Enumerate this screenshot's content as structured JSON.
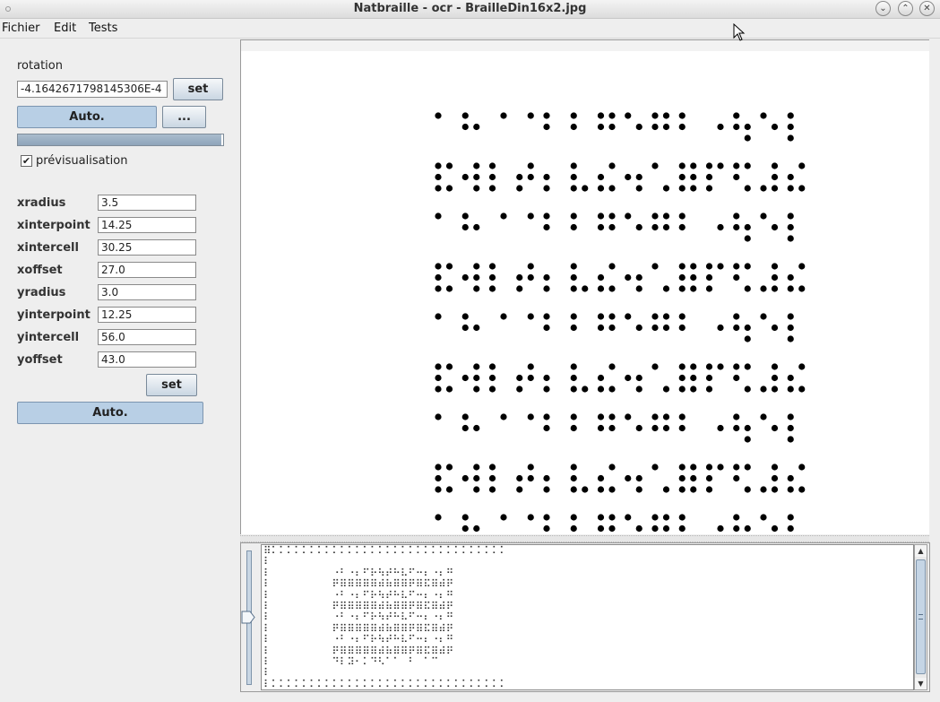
{
  "window": {
    "title": "Natbraille - ocr - BrailleDin16x2.jpg"
  },
  "menu": {
    "items": [
      "Fichier",
      "Edit",
      "Tests"
    ]
  },
  "rotation": {
    "label": "rotation",
    "value": "-4.1642671798145306E-4",
    "set_label": "set",
    "auto_label": "Auto.",
    "more_label": "...",
    "progress": 0.99
  },
  "preview": {
    "label": "prévisualisation",
    "checked": true,
    "mark": "✔"
  },
  "params": [
    {
      "label": "xradius",
      "value": "3.5"
    },
    {
      "label": "xinterpoint",
      "value": "14.25"
    },
    {
      "label": "xintercell",
      "value": "30.25"
    },
    {
      "label": "xoffset",
      "value": "27.0"
    },
    {
      "label": "yradius",
      "value": "3.0"
    },
    {
      "label": "yinterpoint",
      "value": "12.25"
    },
    {
      "label": "yintercell",
      "value": "56.0"
    },
    {
      "label": "yoffset",
      "value": "43.0"
    }
  ],
  "params_set_label": "set",
  "params_auto_label": "Auto.",
  "braille_lines": [
    "⠿⠅⠅⠅⠅⠅⠅⠅⠅⠅⠅⠅⠅⠅⠅⠅⠅⠅⠅⠅⠅⠅⠅⠅⠅⠅⠅⠅⠅⠅⠅⠅",
    "⠇⠀⠀⠀⠀⠀⠀⠀⠀⠀⠀⠀⠀⠀⠀⠀⠀⠀⠀⠀⠀⠀⠀⠀⠀⠀⠀⠀⠀⠀⠀⠀",
    "⠇⠀⠀⠀⠀⠀⠀⠀⠀⠐⠃⠐⠆⠋⠗⠳⠞⠓⠧⠋⠒⠆⠐⠆⠛⠀⠀⠀⠀⠀⠀⠀",
    "⠇⠀⠀⠀⠀⠀⠀⠀⠀⠟⠿⠿⠿⠿⠿⠾⠷⠿⠿⠟⠿⠯⠿⠾⠟⠀⠀⠀⠀⠀⠀⠀",
    "⠇⠀⠀⠀⠀⠀⠀⠀⠀⠐⠃⠐⠆⠋⠗⠳⠞⠓⠧⠋⠒⠆⠐⠆⠛⠀⠀⠀⠀⠀⠀⠀",
    "⠇⠀⠀⠀⠀⠀⠀⠀⠀⠟⠿⠿⠿⠿⠿⠾⠷⠿⠿⠟⠿⠯⠿⠾⠟⠀⠀⠀⠀⠀⠀⠀",
    "⠇⠀⠀⠀⠀⠀⠀⠀⠀⠐⠃⠐⠆⠋⠗⠳⠞⠓⠧⠋⠒⠆⠐⠆⠛⠀⠀⠀⠀⠀⠀⠀",
    "⠇⠀⠀⠀⠀⠀⠀⠀⠀⠟⠿⠿⠿⠿⠿⠾⠷⠿⠿⠟⠿⠯⠿⠾⠟⠀⠀⠀⠀⠀⠀⠀",
    "⠇⠀⠀⠀⠀⠀⠀⠀⠀⠐⠃⠐⠆⠋⠗⠳⠞⠓⠧⠋⠒⠆⠐⠆⠛⠀⠀⠀⠀⠀⠀⠀",
    "⠇⠀⠀⠀⠀⠀⠀⠀⠀⠟⠿⠿⠿⠿⠿⠾⠷⠿⠿⠟⠿⠯⠿⠾⠟⠀⠀⠀⠀⠀⠀⠀",
    "⠇⠀⠀⠀⠀⠀⠀⠀⠀⠙⠇⠽⠂⠅⠙⠣⠁⠁⠀⠃⠀⠁⠉⠀⠀⠀⠀⠀⠀⠀⠀⠀",
    "⠇⠀⠀⠀⠀⠀⠀⠀⠀⠀⠀⠀⠀⠀⠀⠀⠀⠀⠀⠀⠀⠀⠀⠀⠀⠀⠀⠀⠀⠀⠀⠀",
    "⠇⠅⠅⠅⠅⠅⠅⠅⠅⠅⠅⠅⠅⠅⠅⠅⠅⠅⠅⠅⠅⠅⠅⠅⠅⠅⠅⠅⠅⠅⠅⠅"
  ],
  "icons": {
    "window_menu": "dot-icon",
    "minimize": "minimize-icon",
    "maximize": "maximize-icon",
    "close": "close-icon",
    "scroll_up": "arrow-up-icon",
    "scroll_down": "arrow-down-icon",
    "pointer": "mouse-cursor-icon"
  },
  "colors": {
    "button_blue": "#b8cfe5",
    "slider": "#c8d6e4"
  }
}
